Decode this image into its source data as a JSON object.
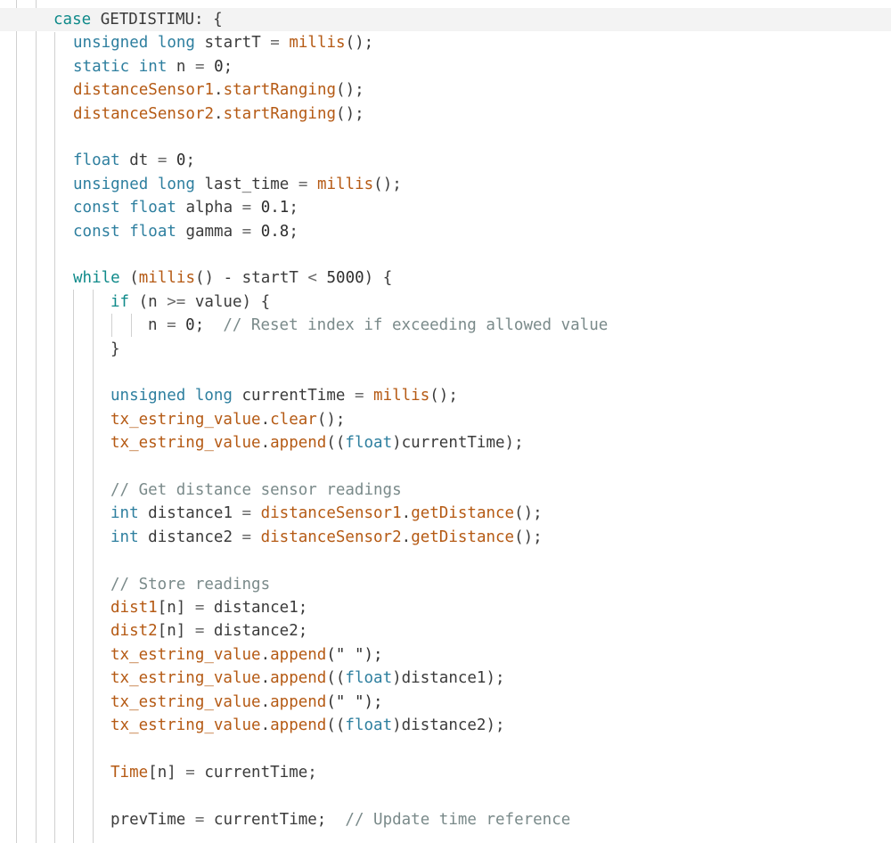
{
  "editor": {
    "lines": [
      {
        "tokens": [
          {
            "t": "case ",
            "c": "c-key"
          },
          {
            "t": "GETDISTIMU",
            "c": "c-plain"
          },
          {
            "t": ": {",
            "c": "c-plain"
          }
        ]
      },
      {
        "tokens": [
          {
            "t": "unsigned ",
            "c": "c-type"
          },
          {
            "t": "long ",
            "c": "c-type"
          },
          {
            "t": "startT",
            "c": "c-plain"
          },
          {
            "t": " = ",
            "c": "c-op"
          },
          {
            "t": "millis",
            "c": "c-fn"
          },
          {
            "t": "();",
            "c": "c-plain"
          }
        ]
      },
      {
        "tokens": [
          {
            "t": "static ",
            "c": "c-type"
          },
          {
            "t": "int ",
            "c": "c-type"
          },
          {
            "t": "n",
            "c": "c-plain"
          },
          {
            "t": " = ",
            "c": "c-op"
          },
          {
            "t": "0",
            "c": "c-num"
          },
          {
            "t": ";",
            "c": "c-plain"
          }
        ]
      },
      {
        "tokens": [
          {
            "t": "distanceSensor1",
            "c": "c-id"
          },
          {
            "t": ".",
            "c": "c-plain"
          },
          {
            "t": "startRanging",
            "c": "c-fn"
          },
          {
            "t": "();",
            "c": "c-plain"
          }
        ]
      },
      {
        "tokens": [
          {
            "t": "distanceSensor2",
            "c": "c-id"
          },
          {
            "t": ".",
            "c": "c-plain"
          },
          {
            "t": "startRanging",
            "c": "c-fn"
          },
          {
            "t": "();",
            "c": "c-plain"
          }
        ]
      },
      {
        "tokens": []
      },
      {
        "tokens": [
          {
            "t": "float ",
            "c": "c-type"
          },
          {
            "t": "dt",
            "c": "c-plain"
          },
          {
            "t": " = ",
            "c": "c-op"
          },
          {
            "t": "0",
            "c": "c-num"
          },
          {
            "t": ";",
            "c": "c-plain"
          }
        ]
      },
      {
        "tokens": [
          {
            "t": "unsigned ",
            "c": "c-type"
          },
          {
            "t": "long ",
            "c": "c-type"
          },
          {
            "t": "last_time",
            "c": "c-plain"
          },
          {
            "t": " = ",
            "c": "c-op"
          },
          {
            "t": "millis",
            "c": "c-fn"
          },
          {
            "t": "();",
            "c": "c-plain"
          }
        ]
      },
      {
        "tokens": [
          {
            "t": "const ",
            "c": "c-type"
          },
          {
            "t": "float ",
            "c": "c-type"
          },
          {
            "t": "alpha",
            "c": "c-plain"
          },
          {
            "t": " = ",
            "c": "c-op"
          },
          {
            "t": "0.1",
            "c": "c-num"
          },
          {
            "t": ";",
            "c": "c-plain"
          }
        ]
      },
      {
        "tokens": [
          {
            "t": "const ",
            "c": "c-type"
          },
          {
            "t": "float ",
            "c": "c-type"
          },
          {
            "t": "gamma",
            "c": "c-plain"
          },
          {
            "t": " = ",
            "c": "c-op"
          },
          {
            "t": "0.8",
            "c": "c-num"
          },
          {
            "t": ";",
            "c": "c-plain"
          }
        ]
      },
      {
        "tokens": []
      },
      {
        "tokens": [
          {
            "t": "while ",
            "c": "c-key"
          },
          {
            "t": "(",
            "c": "c-plain"
          },
          {
            "t": "millis",
            "c": "c-fn"
          },
          {
            "t": "() - ",
            "c": "c-plain"
          },
          {
            "t": "startT",
            "c": "c-plain"
          },
          {
            "t": " < ",
            "c": "c-op"
          },
          {
            "t": "5000",
            "c": "c-num"
          },
          {
            "t": ") {",
            "c": "c-plain"
          }
        ]
      },
      {
        "tokens": [
          {
            "t": "if ",
            "c": "c-key"
          },
          {
            "t": "(n ",
            "c": "c-plain"
          },
          {
            "t": ">= ",
            "c": "c-op"
          },
          {
            "t": "value) {",
            "c": "c-plain"
          }
        ]
      },
      {
        "tokens": [
          {
            "t": "n",
            "c": "c-plain"
          },
          {
            "t": " = ",
            "c": "c-op"
          },
          {
            "t": "0",
            "c": "c-num"
          },
          {
            "t": ";  ",
            "c": "c-plain"
          },
          {
            "t": "// Reset index if exceeding allowed value",
            "c": "c-cmt"
          }
        ]
      },
      {
        "tokens": [
          {
            "t": "}",
            "c": "c-plain"
          }
        ]
      },
      {
        "tokens": []
      },
      {
        "tokens": [
          {
            "t": "unsigned ",
            "c": "c-type"
          },
          {
            "t": "long ",
            "c": "c-type"
          },
          {
            "t": "currentTime",
            "c": "c-plain"
          },
          {
            "t": " = ",
            "c": "c-op"
          },
          {
            "t": "millis",
            "c": "c-fn"
          },
          {
            "t": "();",
            "c": "c-plain"
          }
        ]
      },
      {
        "tokens": [
          {
            "t": "tx_estring_value",
            "c": "c-id"
          },
          {
            "t": ".",
            "c": "c-plain"
          },
          {
            "t": "clear",
            "c": "c-fn"
          },
          {
            "t": "();",
            "c": "c-plain"
          }
        ]
      },
      {
        "tokens": [
          {
            "t": "tx_estring_value",
            "c": "c-id"
          },
          {
            "t": ".",
            "c": "c-plain"
          },
          {
            "t": "append",
            "c": "c-fn"
          },
          {
            "t": "((",
            "c": "c-plain"
          },
          {
            "t": "float",
            "c": "c-type"
          },
          {
            "t": ")currentTime);",
            "c": "c-plain"
          }
        ]
      },
      {
        "tokens": []
      },
      {
        "tokens": [
          {
            "t": "// Get distance sensor readings",
            "c": "c-cmt"
          }
        ]
      },
      {
        "tokens": [
          {
            "t": "int ",
            "c": "c-type"
          },
          {
            "t": "distance1",
            "c": "c-plain"
          },
          {
            "t": " = ",
            "c": "c-op"
          },
          {
            "t": "distanceSensor1",
            "c": "c-id"
          },
          {
            "t": ".",
            "c": "c-plain"
          },
          {
            "t": "getDistance",
            "c": "c-fn"
          },
          {
            "t": "();",
            "c": "c-plain"
          }
        ]
      },
      {
        "tokens": [
          {
            "t": "int ",
            "c": "c-type"
          },
          {
            "t": "distance2",
            "c": "c-plain"
          },
          {
            "t": " = ",
            "c": "c-op"
          },
          {
            "t": "distanceSensor2",
            "c": "c-id"
          },
          {
            "t": ".",
            "c": "c-plain"
          },
          {
            "t": "getDistance",
            "c": "c-fn"
          },
          {
            "t": "();",
            "c": "c-plain"
          }
        ]
      },
      {
        "tokens": []
      },
      {
        "tokens": [
          {
            "t": "// Store readings",
            "c": "c-cmt"
          }
        ]
      },
      {
        "tokens": [
          {
            "t": "dist1",
            "c": "c-id"
          },
          {
            "t": "[n]",
            "c": "c-plain"
          },
          {
            "t": " = ",
            "c": "c-op"
          },
          {
            "t": "distance1;",
            "c": "c-plain"
          }
        ]
      },
      {
        "tokens": [
          {
            "t": "dist2",
            "c": "c-id"
          },
          {
            "t": "[n]",
            "c": "c-plain"
          },
          {
            "t": " = ",
            "c": "c-op"
          },
          {
            "t": "distance2;",
            "c": "c-plain"
          }
        ]
      },
      {
        "tokens": [
          {
            "t": "tx_estring_value",
            "c": "c-id"
          },
          {
            "t": ".",
            "c": "c-plain"
          },
          {
            "t": "append",
            "c": "c-fn"
          },
          {
            "t": "(\" \");",
            "c": "c-str"
          }
        ]
      },
      {
        "tokens": [
          {
            "t": "tx_estring_value",
            "c": "c-id"
          },
          {
            "t": ".",
            "c": "c-plain"
          },
          {
            "t": "append",
            "c": "c-fn"
          },
          {
            "t": "((",
            "c": "c-plain"
          },
          {
            "t": "float",
            "c": "c-type"
          },
          {
            "t": ")distance1);",
            "c": "c-plain"
          }
        ]
      },
      {
        "tokens": [
          {
            "t": "tx_estring_value",
            "c": "c-id"
          },
          {
            "t": ".",
            "c": "c-plain"
          },
          {
            "t": "append",
            "c": "c-fn"
          },
          {
            "t": "(\" \");",
            "c": "c-str"
          }
        ]
      },
      {
        "tokens": [
          {
            "t": "tx_estring_value",
            "c": "c-id"
          },
          {
            "t": ".",
            "c": "c-plain"
          },
          {
            "t": "append",
            "c": "c-fn"
          },
          {
            "t": "((",
            "c": "c-plain"
          },
          {
            "t": "float",
            "c": "c-type"
          },
          {
            "t": ")distance2);",
            "c": "c-plain"
          }
        ]
      },
      {
        "tokens": []
      },
      {
        "tokens": [
          {
            "t": "Time",
            "c": "c-id"
          },
          {
            "t": "[n]",
            "c": "c-plain"
          },
          {
            "t": " = ",
            "c": "c-op"
          },
          {
            "t": "currentTime;",
            "c": "c-plain"
          }
        ]
      },
      {
        "tokens": []
      },
      {
        "tokens": [
          {
            "t": "prevTime",
            "c": "c-plain"
          },
          {
            "t": " = ",
            "c": "c-op"
          },
          {
            "t": "currentTime;  ",
            "c": "c-plain"
          },
          {
            "t": "// Update time reference",
            "c": "c-cmt"
          }
        ]
      }
    ]
  }
}
